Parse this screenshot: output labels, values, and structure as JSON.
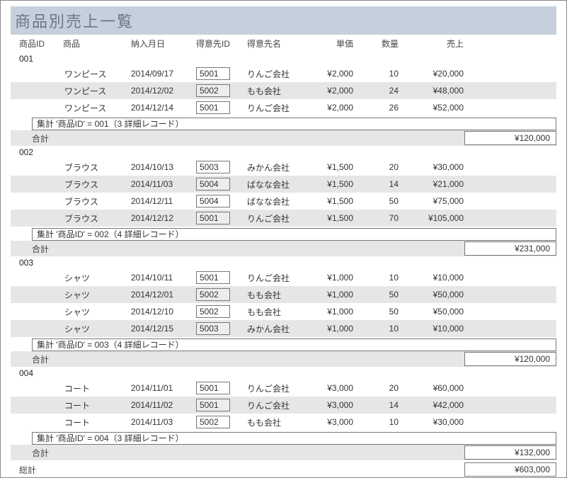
{
  "title": "商品別売上一覧",
  "headers": {
    "product_id": "商品ID",
    "product": "商品",
    "date": "納入月日",
    "customer_id": "得意先ID",
    "customer_name": "得意先名",
    "unit_price": "単価",
    "quantity": "数量",
    "sales": "売上"
  },
  "labels": {
    "subtotal_prefix": "集計 '商品ID' = ",
    "subtotal_suffix_open": "（",
    "subtotal_suffix_close": " 詳細レコード）",
    "subtotal_label": "合計",
    "grand_total_label": "総計"
  },
  "groups": [
    {
      "id": "001",
      "agg_text": "集計 '商品ID' =  001（3 詳細レコード）",
      "subtotal": "¥120,000",
      "rows": [
        {
          "name": "ワンピース",
          "date": "2014/09/17",
          "cid": "5001",
          "cust": "りんご会社",
          "price": "¥2,000",
          "qty": "10",
          "sales": "¥20,000",
          "alt": false
        },
        {
          "name": "ワンピース",
          "date": "2014/12/02",
          "cid": "5002",
          "cust": "もも会社",
          "price": "¥2,000",
          "qty": "24",
          "sales": "¥48,000",
          "alt": true
        },
        {
          "name": "ワンピース",
          "date": "2014/12/14",
          "cid": "5001",
          "cust": "りんご会社",
          "price": "¥2,000",
          "qty": "26",
          "sales": "¥52,000",
          "alt": false
        }
      ]
    },
    {
      "id": "002",
      "agg_text": "集計 '商品ID' =  002（4 詳細レコード）",
      "subtotal": "¥231,000",
      "rows": [
        {
          "name": "ブラウス",
          "date": "2014/10/13",
          "cid": "5003",
          "cust": "みかん会社",
          "price": "¥1,500",
          "qty": "20",
          "sales": "¥30,000",
          "alt": false
        },
        {
          "name": "ブラウス",
          "date": "2014/11/03",
          "cid": "5004",
          "cust": "ばなな会社",
          "price": "¥1,500",
          "qty": "14",
          "sales": "¥21,000",
          "alt": true
        },
        {
          "name": "ブラウス",
          "date": "2014/12/11",
          "cid": "5004",
          "cust": "ばなな会社",
          "price": "¥1,500",
          "qty": "50",
          "sales": "¥75,000",
          "alt": false
        },
        {
          "name": "ブラウス",
          "date": "2014/12/12",
          "cid": "5001",
          "cust": "りんご会社",
          "price": "¥1,500",
          "qty": "70",
          "sales": "¥105,000",
          "alt": true
        }
      ]
    },
    {
      "id": "003",
      "agg_text": "集計 '商品ID' =  003（4 詳細レコード）",
      "subtotal": "¥120,000",
      "rows": [
        {
          "name": "シャツ",
          "date": "2014/10/11",
          "cid": "5001",
          "cust": "りんご会社",
          "price": "¥1,000",
          "qty": "10",
          "sales": "¥10,000",
          "alt": false
        },
        {
          "name": "シャツ",
          "date": "2014/12/01",
          "cid": "5002",
          "cust": "もも会社",
          "price": "¥1,000",
          "qty": "50",
          "sales": "¥50,000",
          "alt": true
        },
        {
          "name": "シャツ",
          "date": "2014/12/10",
          "cid": "5002",
          "cust": "もも会社",
          "price": "¥1,000",
          "qty": "50",
          "sales": "¥50,000",
          "alt": false
        },
        {
          "name": "シャツ",
          "date": "2014/12/15",
          "cid": "5003",
          "cust": "みかん会社",
          "price": "¥1,000",
          "qty": "10",
          "sales": "¥10,000",
          "alt": true
        }
      ]
    },
    {
      "id": "004",
      "agg_text": "集計 '商品ID' =  004（3 詳細レコード）",
      "subtotal": "¥132,000",
      "rows": [
        {
          "name": "コート",
          "date": "2014/11/01",
          "cid": "5001",
          "cust": "りんご会社",
          "price": "¥3,000",
          "qty": "20",
          "sales": "¥60,000",
          "alt": false
        },
        {
          "name": "コート",
          "date": "2014/11/02",
          "cid": "5001",
          "cust": "りんご会社",
          "price": "¥3,000",
          "qty": "14",
          "sales": "¥42,000",
          "alt": true
        },
        {
          "name": "コート",
          "date": "2014/11/03",
          "cid": "5002",
          "cust": "もも会社",
          "price": "¥3,000",
          "qty": "10",
          "sales": "¥30,000",
          "alt": false
        }
      ]
    }
  ],
  "grand_total": "¥603,000"
}
